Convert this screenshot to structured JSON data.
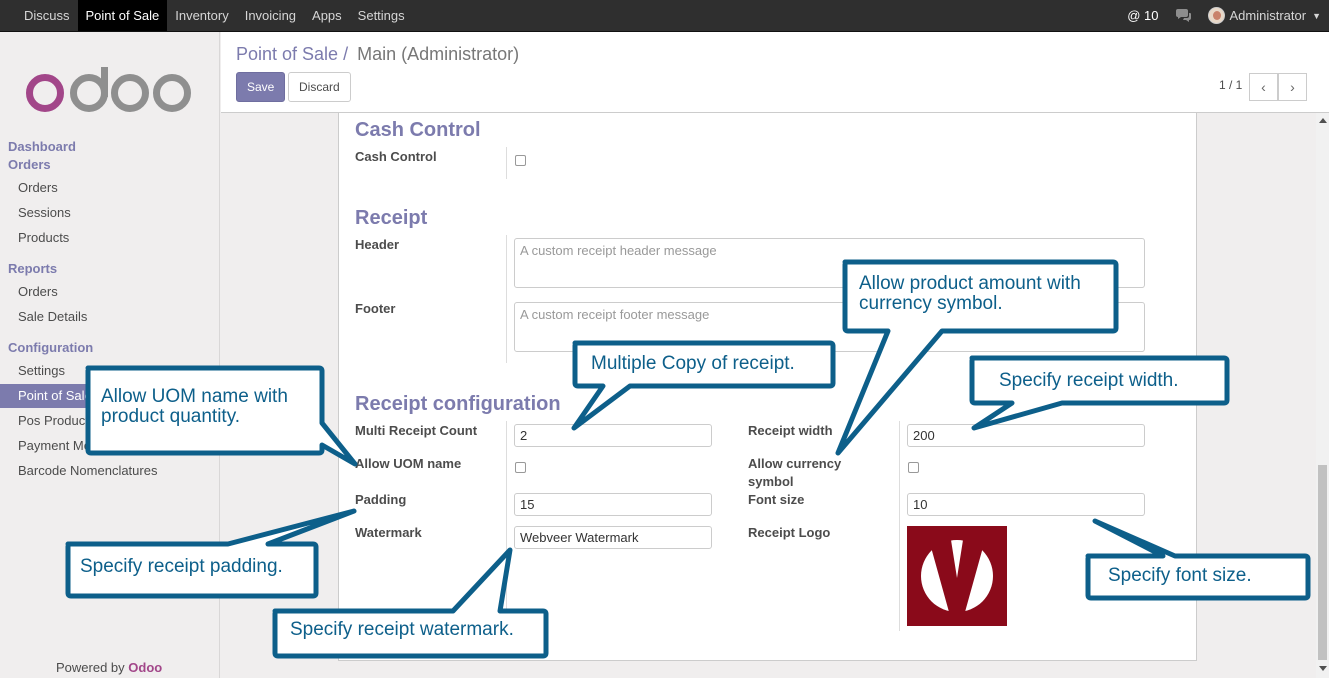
{
  "topbar": {
    "menu": [
      "Discuss",
      "Point of Sale",
      "Inventory",
      "Invoicing",
      "Apps",
      "Settings"
    ],
    "active_menu": "Point of Sale",
    "mentions": "@ 10",
    "user": "Administrator"
  },
  "sidebar": {
    "sections": {
      "dashboard": "Dashboard",
      "orders": "Orders",
      "reports": "Reports",
      "configuration": "Configuration"
    },
    "orders_items": [
      "Orders",
      "Sessions",
      "Products"
    ],
    "reports_items": [
      "Orders",
      "Sale Details"
    ],
    "config_items": [
      "Settings",
      "Point of Sale",
      "Pos Products",
      "Payment Methods",
      "Barcode Nomenclatures"
    ],
    "powered_prefix": "Powered by",
    "powered_brand": "Odoo"
  },
  "control_panel": {
    "breadcrumb_parent": "Point of Sale /",
    "breadcrumb_current": "Main (Administrator)",
    "save_label": "Save",
    "discard_label": "Discard",
    "pager": "1 / 1"
  },
  "form": {
    "cash_control_title": "Cash Control",
    "cash_control_label": "Cash Control",
    "cash_control_checked": false,
    "receipt_title": "Receipt",
    "header_label": "Header",
    "header_placeholder": "A custom receipt header message",
    "footer_label": "Footer",
    "footer_placeholder": "A custom receipt footer message",
    "receipt_config_title": "Receipt configuration",
    "multi_receipt_count_label": "Multi Receipt Count",
    "multi_receipt_count_value": "2",
    "allow_uom_label": "Allow UOM name",
    "allow_uom_checked": false,
    "padding_label": "Padding",
    "padding_value": "15",
    "watermark_label": "Watermark",
    "watermark_value": "Webveer Watermark",
    "receipt_width_label": "Receipt width",
    "receipt_width_value": "200",
    "allow_currency_label_1": "Allow currency",
    "allow_currency_label_2": "symbol",
    "allow_currency_checked": false,
    "font_size_label": "Font size",
    "font_size_value": "10",
    "receipt_logo_label": "Receipt Logo"
  },
  "callouts": {
    "allow_currency": [
      "Allow product amount with",
      "currency symbol."
    ],
    "multiple_copy": "Multiple Copy of receipt.",
    "receipt_width": "Specify receipt width.",
    "allow_uom": [
      "Allow UOM name with",
      "product quantity."
    ],
    "padding": "Specify receipt padding.",
    "watermark": "Specify receipt watermark.",
    "font_size": "Specify font size."
  },
  "colors": {
    "accent": "#7c7bad",
    "callout_border": "#0d5f8a",
    "callout_text": "#0d5f8a",
    "logo_bg": "#8a0a1a"
  }
}
